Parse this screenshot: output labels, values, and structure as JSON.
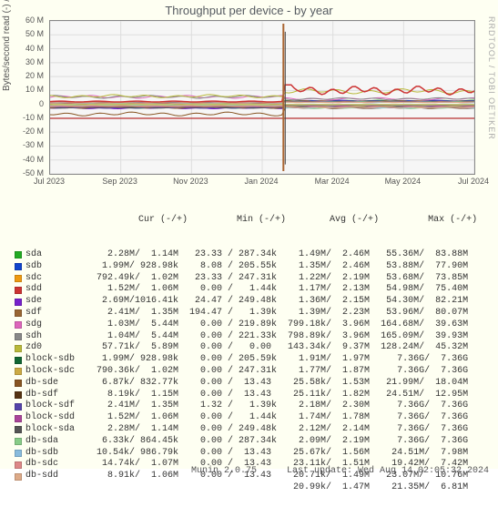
{
  "watermark": "RRDTOOL / TOBI OETIKER",
  "chart_data": {
    "type": "line",
    "title": "Throughput per device - by year",
    "ylabel": "Bytes/second read (-) / write (+)",
    "ylim": [
      -50000000,
      60000000
    ],
    "yticks": [
      -50000000,
      -40000000,
      -30000000,
      -20000000,
      -10000000,
      0,
      10000000,
      20000000,
      30000000,
      40000000,
      50000000,
      60000000
    ],
    "ytick_labels": [
      "-50 M",
      "-40 M",
      "-30 M",
      "-20 M",
      "-10 M",
      "0",
      "10 M",
      "20 M",
      "30 M",
      "40 M",
      "50 M",
      "60 M"
    ],
    "xticks": [
      "Jul 2023",
      "Sep 2023",
      "Nov 2023",
      "Jan 2024",
      "Mar 2024",
      "May 2024",
      "Jul 2024"
    ],
    "feb_spike_x": 0.55,
    "series": [
      {
        "name": "sda",
        "color": "#22aa22",
        "baseline_read": -2.3,
        "baseline_write": 1.1,
        "post_read": -1.5,
        "post_write": 2.5
      },
      {
        "name": "sdb",
        "color": "#1144cc",
        "baseline_read": -2.0,
        "baseline_write": 0.9,
        "post_read": -1.4,
        "post_write": 2.5
      },
      {
        "name": "sdc",
        "color": "#ee9911",
        "baseline_read": -0.8,
        "baseline_write": 1.0,
        "post_read": -1.2,
        "post_write": 2.2
      },
      {
        "name": "sdd",
        "color": "#cc3333",
        "baseline_read": -1.5,
        "baseline_write": 1.1,
        "post_read": -1.2,
        "post_write": 2.1
      },
      {
        "name": "sde",
        "color": "#7722cc",
        "baseline_read": -2.7,
        "baseline_write": 1.0,
        "post_read": -1.4,
        "post_write": 2.2
      },
      {
        "name": "sdf",
        "color": "#996633",
        "baseline_read": -2.4,
        "baseline_write": 1.4,
        "post_read": -1.4,
        "post_write": 2.2
      },
      {
        "name": "sdg",
        "color": "#dd66bb",
        "baseline_read": -1.0,
        "baseline_write": 5.4,
        "post_read": -0.8,
        "post_write": 4.0
      },
      {
        "name": "sdh",
        "color": "#888888",
        "baseline_read": -1.0,
        "baseline_write": 5.4,
        "post_read": -0.8,
        "post_write": 4.0
      },
      {
        "name": "zd0",
        "color": "#b9b93a",
        "baseline_read": -0.06,
        "baseline_write": 5.9,
        "post_read": -0.14,
        "post_write": 9.4
      },
      {
        "name": "block-sdb",
        "color": "#116633",
        "baseline_read": -2.0,
        "baseline_write": 0.9,
        "post_read": -1.9,
        "post_write": 2.0
      },
      {
        "name": "block-sdc",
        "color": "#ccaa44",
        "baseline_read": -0.8,
        "baseline_write": 1.0,
        "post_read": -1.8,
        "post_write": 1.9
      },
      {
        "name": "block-sde",
        "color": "#885522",
        "baseline_read": -6.9,
        "baseline_write": 0.8,
        "post_read": -2.5,
        "post_write": 1.5
      },
      {
        "name": "db-sdf",
        "color": "#553311",
        "baseline_read": -0.8,
        "baseline_write": 1.2,
        "post_read": -2.5,
        "post_write": 1.8
      },
      {
        "name": "block-sdf",
        "color": "#5544aa",
        "baseline_read": -2.4,
        "baseline_write": 1.4,
        "post_read": -2.2,
        "post_write": 2.3
      },
      {
        "name": "block-sdd",
        "color": "#aa4499",
        "baseline_read": -1.5,
        "baseline_write": 1.1,
        "post_read": -1.7,
        "post_write": 1.8
      },
      {
        "name": "block-sda",
        "color": "#555555",
        "baseline_read": -2.3,
        "baseline_write": 1.1,
        "post_read": -2.1,
        "post_write": 2.2
      },
      {
        "name": "db-sda",
        "color": "#88cc88",
        "baseline_read": -0.6,
        "baseline_write": 0.9,
        "post_read": -2.5,
        "post_write": 1.6
      },
      {
        "name": "db-sdb",
        "color": "#88bbdd",
        "baseline_read": -1.0,
        "baseline_write": 1.0,
        "post_read": -2.3,
        "post_write": 1.5
      },
      {
        "name": "db-sdc",
        "color": "#dd8888",
        "baseline_read": -1.5,
        "baseline_write": 1.1,
        "post_read": -2.1,
        "post_write": 1.5
      },
      {
        "name": "db-sdd",
        "color": "#ddaa88",
        "baseline_read": -0.9,
        "baseline_write": 1.1,
        "post_read": -2.1,
        "post_write": 1.5
      }
    ],
    "spike_up": 58,
    "spike_down": -48,
    "red_jump_series": {
      "color": "#cc3333",
      "pre": 2.0,
      "post_avg": 10,
      "post_peak": 14
    }
  },
  "legend": {
    "header_cols": [
      "",
      "Cur (-/+)",
      "Min (-/+)",
      "Avg (-/+)",
      "Max (-/+)"
    ],
    "rows": [
      {
        "color": "#22aa22",
        "name": "sda",
        "cur": "2.28M/  1.14M",
        "min": "23.33 / 287.34k",
        "avg": "1.49M/  2.46M",
        "max": "55.36M/  83.88M"
      },
      {
        "color": "#1144cc",
        "name": "sdb",
        "cur": "1.99M/ 928.98k",
        "min": "8.08 / 205.55k",
        "avg": "1.35M/  2.46M",
        "max": "53.88M/  77.90M"
      },
      {
        "color": "#ee9911",
        "name": "sdc",
        "cur": "792.49k/  1.02M",
        "min": "23.33 / 247.31k",
        "avg": "1.22M/  2.19M",
        "max": "53.68M/  73.85M"
      },
      {
        "color": "#cc3333",
        "name": "sdd",
        "cur": "1.52M/  1.06M",
        "min": "0.00 /   1.44k",
        "avg": "1.17M/  2.13M",
        "max": "54.98M/  75.40M"
      },
      {
        "color": "#7722cc",
        "name": "sde",
        "cur": "2.69M/1016.41k",
        "min": "24.47 / 249.48k",
        "avg": "1.36M/  2.15M",
        "max": "54.30M/  82.21M"
      },
      {
        "color": "#996633",
        "name": "sdf",
        "cur": "2.41M/  1.35M",
        "min": "194.47 /   1.39k",
        "avg": "1.39M/  2.23M",
        "max": "53.96M/  80.07M"
      },
      {
        "color": "#dd66bb",
        "name": "sdg",
        "cur": "1.03M/  5.44M",
        "min": "0.00 / 219.89k",
        "avg": "799.18k/  3.96M",
        "max": "164.68M/  39.63M"
      },
      {
        "color": "#888888",
        "name": "sdh",
        "cur": "1.04M/  5.44M",
        "min": "0.00 / 221.33k",
        "avg": "798.89k/  3.96M",
        "max": "165.09M/  39.93M"
      },
      {
        "color": "#b9b93a",
        "name": "zd0",
        "cur": "57.71k/  5.89M",
        "min": "0.00 /   0.00 ",
        "avg": "143.34k/  9.37M",
        "max": "128.24M/  45.32M"
      },
      {
        "color": "#116633",
        "name": "block-sdb",
        "cur": "1.99M/ 928.98k",
        "min": "0.00 / 205.59k",
        "avg": "1.91M/  1.97M",
        "max": "7.36G/  7.36G"
      },
      {
        "color": "#ccaa44",
        "name": "block-sdc",
        "cur": "790.36k/  1.02M",
        "min": "0.00 / 247.31k",
        "avg": "1.77M/  1.87M",
        "max": "7.36G/  7.36G"
      },
      {
        "color": "#885522",
        "name": "db-sde",
        "cur": "6.87k/ 832.77k",
        "min": "0.00 /  13.43 ",
        "avg": "25.58k/  1.53M",
        "max": "21.99M/  18.04M"
      },
      {
        "color": "#553311",
        "name": "db-sdf",
        "cur": "8.19k/  1.15M",
        "min": "0.00 /  13.43 ",
        "avg": "25.11k/  1.82M",
        "max": "24.51M/  12.95M"
      },
      {
        "color": "#5544aa",
        "name": "block-sdf",
        "cur": "2.41M/  1.35M",
        "min": "1.32 /   1.39k",
        "avg": "2.18M/  2.30M",
        "max": "7.36G/  7.36G"
      },
      {
        "color": "#aa4499",
        "name": "block-sdd",
        "cur": "1.52M/  1.06M",
        "min": "0.00 /   1.44k",
        "avg": "1.74M/  1.78M",
        "max": "7.36G/  7.36G"
      },
      {
        "color": "#555555",
        "name": "block-sda",
        "cur": "2.28M/  1.14M",
        "min": "0.00 / 249.48k",
        "avg": "2.12M/  2.14M",
        "max": "7.36G/  7.36G"
      },
      {
        "color": "#88cc88",
        "name": "db-sda",
        "cur": "6.33k/ 864.45k",
        "min": "0.00 / 287.34k",
        "avg": "2.09M/  2.19M",
        "max": "7.36G/  7.36G"
      },
      {
        "color": "#88bbdd",
        "name": "db-sdb",
        "cur": "10.54k/ 986.79k",
        "min": "0.00 /  13.43 ",
        "avg": "25.67k/  1.56M",
        "max": "24.51M/  7.98M"
      },
      {
        "color": "#dd8888",
        "name": "db-sdc",
        "cur": "14.74k/  1.07M",
        "min": "0.00 /  13.43 ",
        "avg": "23.11k/  1.51M",
        "max": "19.42M/  7.42M"
      },
      {
        "color": "#ddaa88",
        "name": "db-sdd",
        "cur": "8.91k/  1.06M",
        "min": "0.00 /  13.43 ",
        "avg": "20.71k/  1.49M",
        "max": "23.07M/  10.76M"
      },
      {
        "color": null,
        "name": "",
        "cur": "",
        "min": "",
        "avg": "20.99k/  1.47M",
        "max": "21.35M/  6.81M"
      }
    ]
  },
  "footer": {
    "generator": "Munin 2.0.75",
    "last_update": "Last update: Wed Aug 14 02:05:32 2024"
  }
}
